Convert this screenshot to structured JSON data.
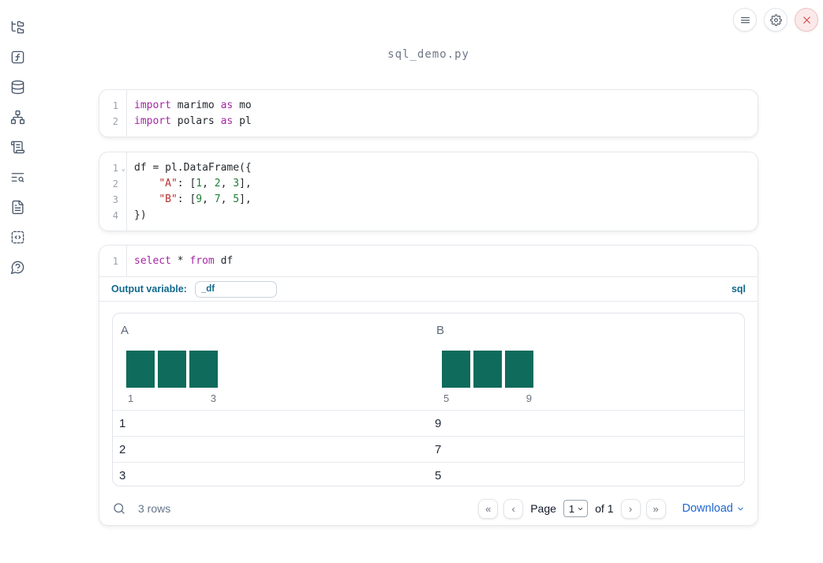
{
  "window": {
    "title": "sql_demo.py"
  },
  "topbar": {
    "buttons": [
      {
        "icon": "hamburger-menu-icon"
      },
      {
        "icon": "gear-icon"
      },
      {
        "icon": "close-icon"
      }
    ]
  },
  "sidebar": {
    "items": [
      {
        "icon": "file-tree-icon"
      },
      {
        "icon": "function-square-icon"
      },
      {
        "icon": "database-icon"
      },
      {
        "icon": "dependency-graph-icon"
      },
      {
        "icon": "scroll-log-icon"
      },
      {
        "icon": "text-search-icon"
      },
      {
        "icon": "document-icon"
      },
      {
        "icon": "code-snippet-icon"
      },
      {
        "icon": "help-icon"
      }
    ]
  },
  "cells": [
    {
      "lines": [
        {
          "n": "1",
          "tokens": [
            [
              "kw",
              "import"
            ],
            [
              "pl",
              " marimo "
            ],
            [
              "kw",
              "as"
            ],
            [
              "pl",
              " mo"
            ]
          ]
        },
        {
          "n": "2",
          "tokens": [
            [
              "kw",
              "import"
            ],
            [
              "pl",
              " polars "
            ],
            [
              "kw",
              "as"
            ],
            [
              "pl",
              " pl"
            ]
          ]
        }
      ]
    },
    {
      "lines": [
        {
          "n": "1",
          "fold": true,
          "tokens": [
            [
              "pl",
              "df = pl.DataFrame({"
            ]
          ]
        },
        {
          "n": "2",
          "tokens": [
            [
              "pl",
              "    "
            ],
            [
              "str",
              "\"A\""
            ],
            [
              "pl",
              ": ["
            ],
            [
              "num",
              "1"
            ],
            [
              "pl",
              ", "
            ],
            [
              "num",
              "2"
            ],
            [
              "pl",
              ", "
            ],
            [
              "num",
              "3"
            ],
            [
              "pl",
              "],"
            ]
          ]
        },
        {
          "n": "3",
          "tokens": [
            [
              "pl",
              "    "
            ],
            [
              "str",
              "\"B\""
            ],
            [
              "pl",
              ": ["
            ],
            [
              "num",
              "9"
            ],
            [
              "pl",
              ", "
            ],
            [
              "num",
              "7"
            ],
            [
              "pl",
              ", "
            ],
            [
              "num",
              "5"
            ],
            [
              "pl",
              "],"
            ]
          ]
        },
        {
          "n": "4",
          "tokens": [
            [
              "pl",
              "})"
            ]
          ]
        }
      ]
    },
    {
      "lines": [
        {
          "n": "1",
          "tokens": [
            [
              "kw",
              "select"
            ],
            [
              "pl",
              " * "
            ],
            [
              "kw",
              "from"
            ],
            [
              "pl",
              " df"
            ]
          ]
        }
      ]
    }
  ],
  "sql_cell": {
    "output_variable_label": "Output variable:",
    "output_variable_value": "_df",
    "language_badge": "sql"
  },
  "table": {
    "columns": [
      {
        "name": "A",
        "histogram": {
          "values": [
            1,
            1,
            1
          ],
          "min_label": "1",
          "max_label": "3"
        }
      },
      {
        "name": "B",
        "histogram": {
          "values": [
            1,
            1,
            1
          ],
          "min_label": "5",
          "max_label": "9"
        }
      }
    ],
    "rows": [
      [
        "1",
        "9"
      ],
      [
        "2",
        "7"
      ],
      [
        "3",
        "5"
      ]
    ],
    "footer": {
      "row_count": "3 rows",
      "pagination": {
        "first": "«",
        "prev": "‹",
        "page_label": "Page",
        "page_value": "1",
        "of_label": "of 1",
        "next": "›",
        "last": "»"
      },
      "download_label": "Download"
    }
  },
  "colors": {
    "sql_accent": "#11698e",
    "histogram_bar": "#0f6b5c",
    "keyword": "#a626a4",
    "string": "#b5312c",
    "number": "#1a7f37",
    "link_blue": "#2166d1",
    "close_red": "#d64545",
    "sidebar_icon": "#475569"
  }
}
